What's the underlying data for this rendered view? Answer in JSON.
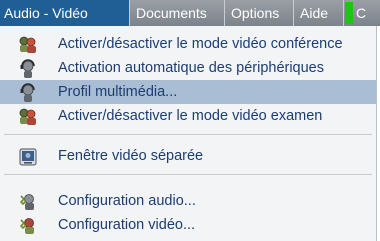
{
  "menubar": {
    "tabs": [
      {
        "label": "Audio - Vidéo",
        "active": true
      },
      {
        "label": "Documents"
      },
      {
        "label": "Options"
      },
      {
        "label": "Aide"
      }
    ],
    "overflow_label": "C",
    "accent_color": "#22c21a",
    "active_color": "#1f5f96"
  },
  "menu": {
    "items": [
      {
        "label": "Activer/désactiver le mode vidéo conférence",
        "icon": "users-video-icon"
      },
      {
        "label": "Activation automatique des périphériques",
        "icon": "headset-user-icon"
      },
      {
        "label": "Profil multimédia...",
        "icon": "headset-user-icon",
        "highlighted": true
      },
      {
        "label": "Activer/désactiver le mode vidéo examen",
        "icon": "users-video-icon"
      },
      {
        "label": "Fenêtre vidéo séparée",
        "icon": "video-window-icon"
      },
      {
        "label": "Configuration audio...",
        "icon": "audio-config-icon"
      },
      {
        "label": "Configuration vidéo...",
        "icon": "video-config-icon"
      }
    ],
    "highlight_color": "#a9bdd4",
    "text_color": "#1d3d70"
  }
}
